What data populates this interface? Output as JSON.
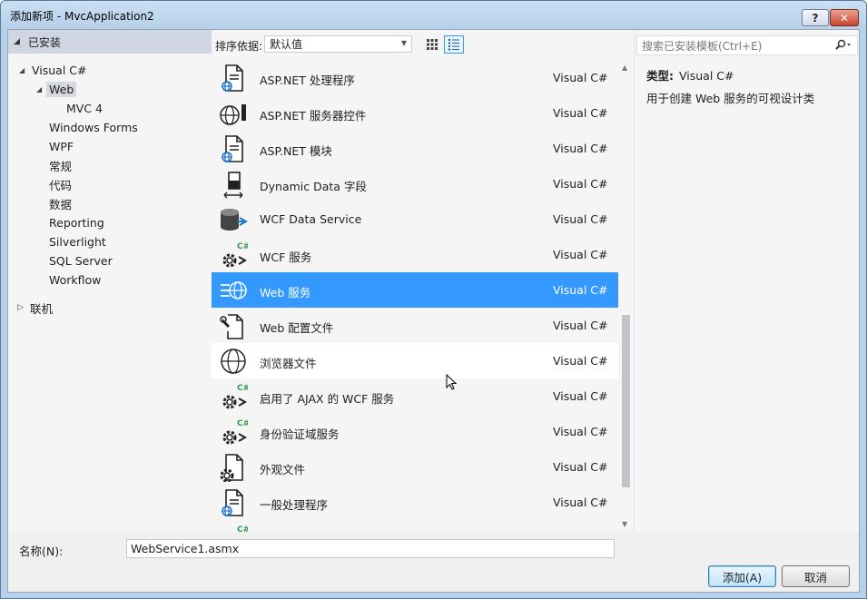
{
  "window": {
    "title": "添加新项 - MvcApplication2",
    "help_label": "?",
    "close_label": "✕"
  },
  "left_panel": {
    "installed_label": "已安装",
    "tree": [
      {
        "label": "Visual C#",
        "level": 0,
        "expander": "open"
      },
      {
        "label": "Web",
        "level": 1,
        "expander": "open",
        "selected": true
      },
      {
        "label": "MVC 4",
        "level": 2
      },
      {
        "label": "Windows Forms",
        "level": 1
      },
      {
        "label": "WPF",
        "level": 1
      },
      {
        "label": "常规",
        "level": 1
      },
      {
        "label": "代码",
        "level": 1
      },
      {
        "label": "数据",
        "level": 1
      },
      {
        "label": "Reporting",
        "level": 1
      },
      {
        "label": "Silverlight",
        "level": 1
      },
      {
        "label": "SQL Server",
        "level": 1
      },
      {
        "label": "Workflow",
        "level": 1
      }
    ],
    "online_label": "联机"
  },
  "toolbar": {
    "sort_label": "排序依据:",
    "sort_value": "默认值"
  },
  "templates": [
    {
      "name": "ASP.NET 处理程序",
      "lang": "Visual C#",
      "icon": "handler-page-icon"
    },
    {
      "name": "ASP.NET 服务器控件",
      "lang": "Visual C#",
      "icon": "server-control-icon"
    },
    {
      "name": "ASP.NET 模块",
      "lang": "Visual C#",
      "icon": "module-page-icon"
    },
    {
      "name": "Dynamic Data 字段",
      "lang": "Visual C#",
      "icon": "dynamic-data-field-icon"
    },
    {
      "name": "WCF Data Service",
      "lang": "Visual C#",
      "icon": "data-service-icon"
    },
    {
      "name": "WCF 服务",
      "lang": "Visual C#",
      "icon": "wcf-service-icon"
    },
    {
      "name": "Web 服务",
      "lang": "Visual C#",
      "icon": "web-service-icon",
      "selected": true
    },
    {
      "name": "Web 配置文件",
      "lang": "Visual C#",
      "icon": "web-config-icon"
    },
    {
      "name": "浏览器文件",
      "lang": "Visual C#",
      "icon": "browser-file-icon",
      "hovered": true
    },
    {
      "name": "启用了 AJAX 的 WCF 服务",
      "lang": "Visual C#",
      "icon": "ajax-wcf-service-icon"
    },
    {
      "name": "身份验证域服务",
      "lang": "Visual C#",
      "icon": "auth-domain-service-icon"
    },
    {
      "name": "外观文件",
      "lang": "Visual C#",
      "icon": "skin-file-icon"
    },
    {
      "name": "一般处理程序",
      "lang": "Visual C#",
      "icon": "generic-handler-icon"
    },
    {
      "name": "",
      "lang": "",
      "icon": "partial-service-icon"
    }
  ],
  "right_panel": {
    "search_placeholder": "搜索已安装模板(Ctrl+E)",
    "type_label": "类型:",
    "type_value": "Visual C#",
    "description": "用于创建 Web 服务的可视设计类"
  },
  "footer": {
    "name_label": "名称(N):",
    "name_value": "WebService1.asmx",
    "add_label": "添加(A)",
    "cancel_label": "取消"
  },
  "colors": {
    "selection": "#3399ff",
    "title_gradient": "#c9dff3",
    "icon_green": "#2a9b4a",
    "icon_blue": "#1e73c8"
  }
}
